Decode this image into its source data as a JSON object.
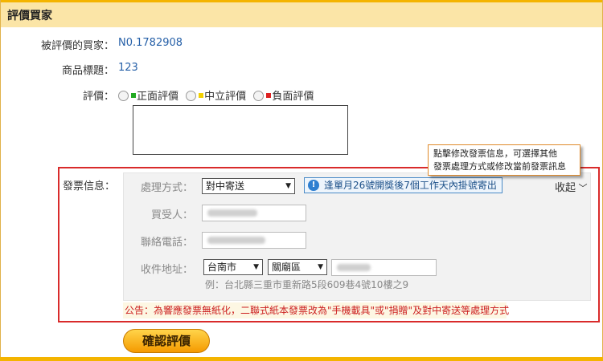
{
  "header": {
    "title": "評價買家"
  },
  "buyer": {
    "label": "被評價的買家：",
    "value": "N0.1782908"
  },
  "product": {
    "label": "商品標題：",
    "value": "123"
  },
  "rating": {
    "label": "評價：",
    "options": [
      {
        "label": "正面評價",
        "color": "#22aa22"
      },
      {
        "label": "中立評價",
        "color": "#f2d000"
      },
      {
        "label": "負面評價",
        "color": "#dd2222"
      }
    ]
  },
  "tooltip": {
    "line1": "點擊修改發票信息，可選擇其他",
    "line2": "發票處理方式或修改當前發票訊息"
  },
  "invoice": {
    "label": "發票信息：",
    "method_label": "處理方式：",
    "method_value": "對中寄送",
    "notice": "逢單月26號開獎後7個工作天內掛號寄出",
    "collapse": "收起",
    "recipient_label": "買受人：",
    "phone_label": "聯絡電話：",
    "address_label": "收件地址：",
    "city": "台南市",
    "district": "關廟區",
    "example": "例：台北縣三重市重新路5段609巷4號10樓之9",
    "announcement": "公告：為響應發票無紙化，二聯式紙本發票改為\"手機載具\"或\"捐贈\"及對中寄送等處理方式"
  },
  "confirm_label": "確認評價"
}
